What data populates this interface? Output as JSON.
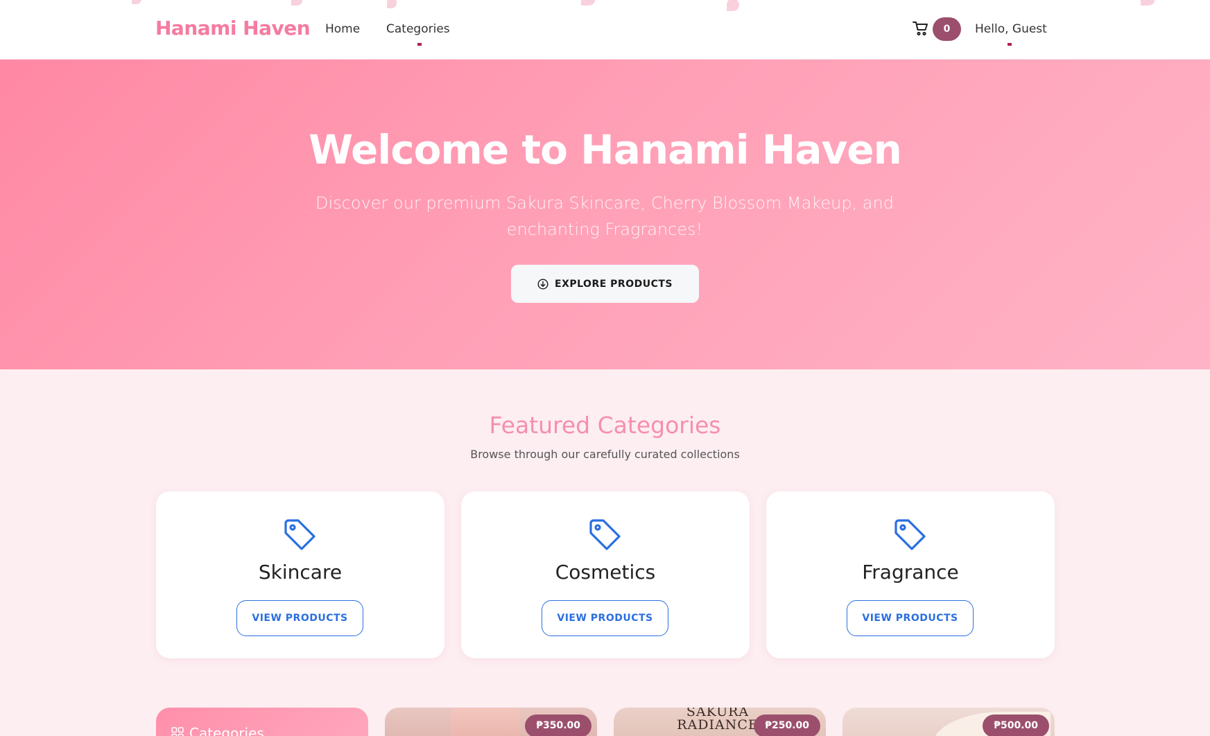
{
  "brand": "Hanami Haven",
  "nav": {
    "home": "Home",
    "categories": "Categories"
  },
  "cart": {
    "count": "0"
  },
  "user": {
    "greeting": "Hello, Guest"
  },
  "hero": {
    "title": "Welcome to Hanami Haven",
    "subtitle": "Discover our premium Sakura Skincare, Cherry Blossom Makeup, and enchanting Fragrances!",
    "button": "EXPLORE PRODUCTS"
  },
  "featured": {
    "title": "Featured Categories",
    "subtitle": "Browse through our carefully curated collections",
    "cards": [
      {
        "name": "Skincare",
        "button": "VIEW PRODUCTS"
      },
      {
        "name": "Cosmetics",
        "button": "VIEW PRODUCTS"
      },
      {
        "name": "Fragrance",
        "button": "VIEW PRODUCTS"
      }
    ]
  },
  "sidebar": {
    "title": "Categories"
  },
  "products": [
    {
      "price": "₱350.00"
    },
    {
      "price": "₱250.00",
      "label_line1": "SAKURA",
      "label_line2": "RADIANCE"
    },
    {
      "price": "₱500.00"
    }
  ],
  "colors": {
    "brand": "#f57ba0",
    "badge": "#9b4f6c",
    "accent_blue": "#2a6fe0",
    "hero_start": "#ff88a4",
    "hero_end": "#ffb3c6"
  },
  "icons": {
    "cart": "cart-icon",
    "tag": "tag-icon",
    "explore": "arrow-down-circle-icon",
    "categories": "grid-icon"
  }
}
